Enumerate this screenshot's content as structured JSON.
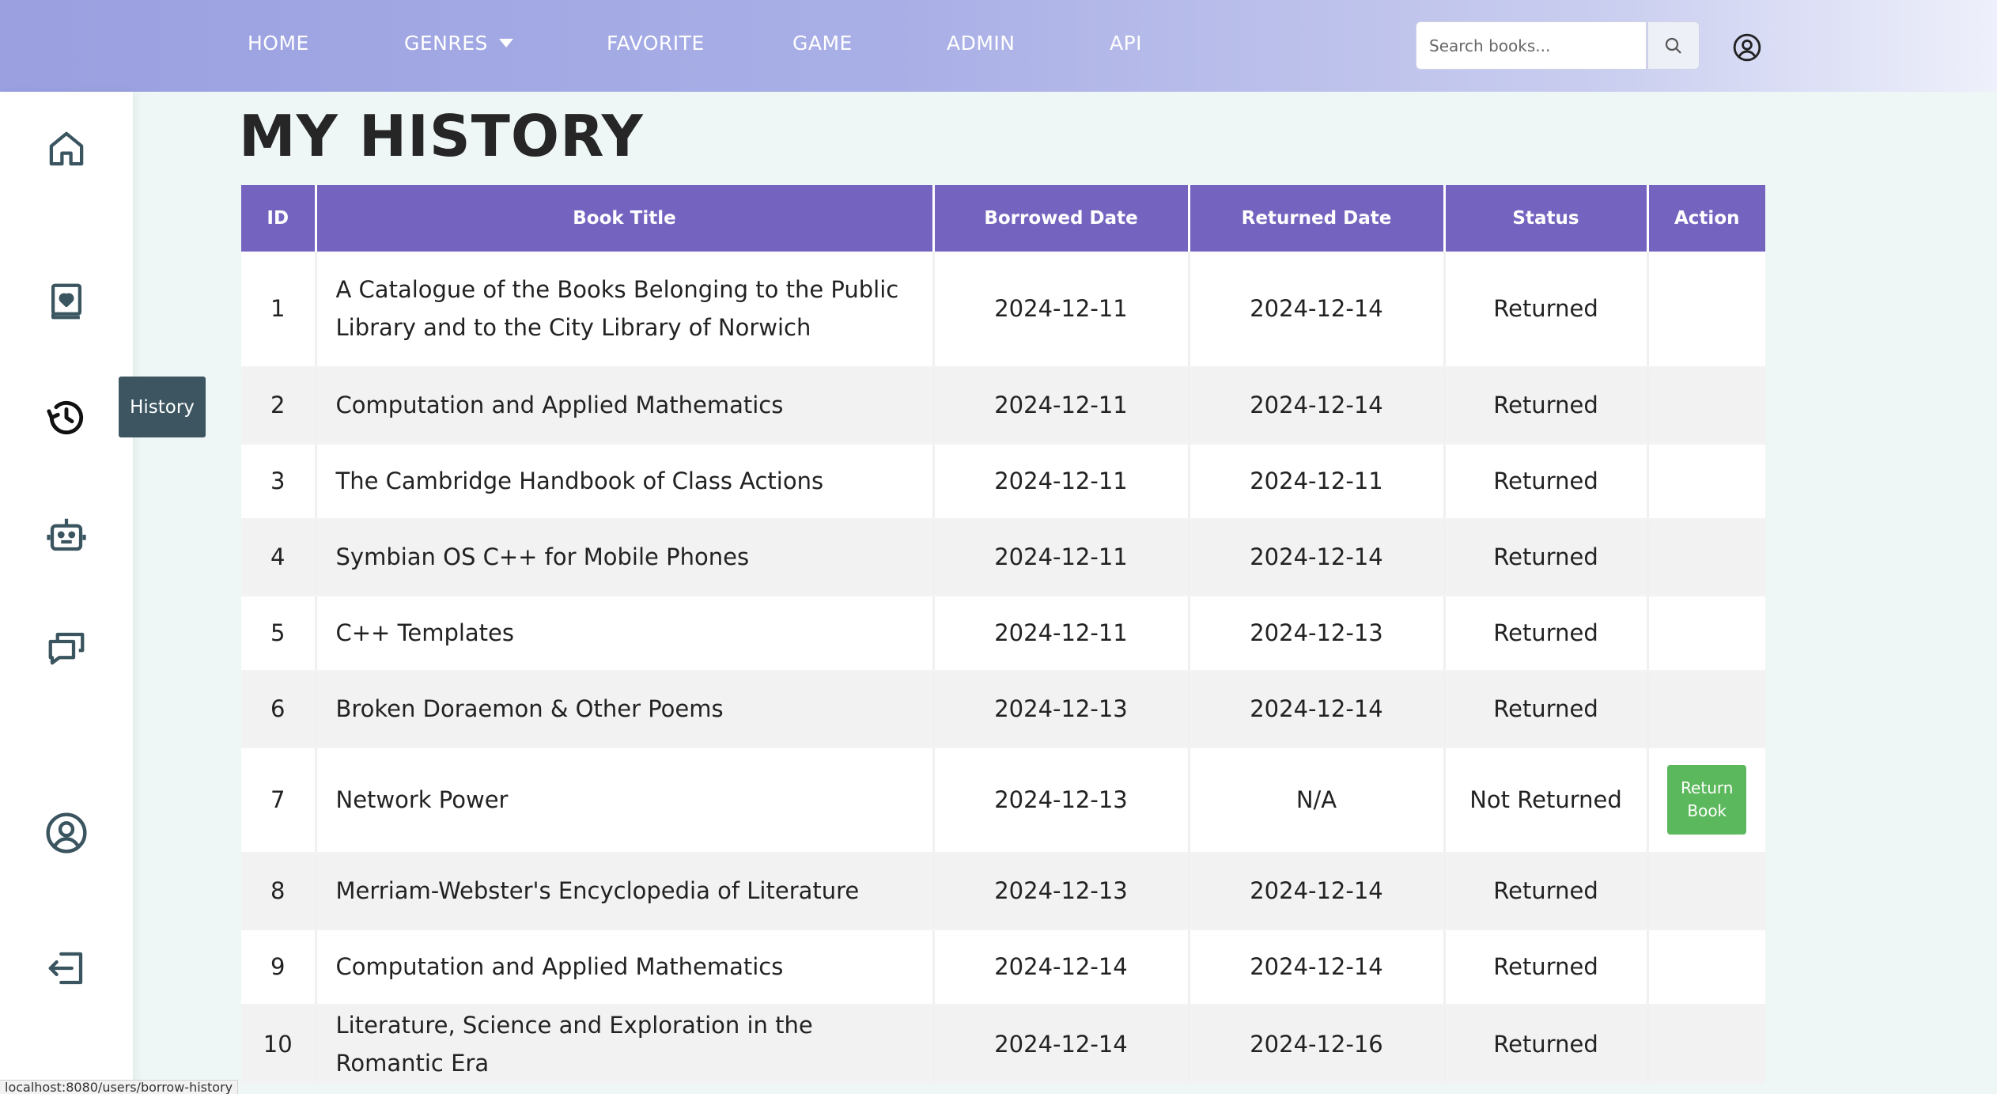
{
  "nav": {
    "items": [
      {
        "label": "HOME"
      },
      {
        "label": "GENRES"
      },
      {
        "label": "FAVORITE"
      },
      {
        "label": "GAME"
      },
      {
        "label": "ADMIN"
      },
      {
        "label": "API"
      }
    ],
    "search_placeholder": "Search books...",
    "search_icon": "search-icon",
    "account_icon": "user-circle-icon"
  },
  "sidebar": {
    "items": [
      {
        "icon": "home-icon"
      },
      {
        "icon": "book-heart-icon"
      },
      {
        "icon": "history-icon",
        "active": true
      },
      {
        "icon": "robot-icon"
      },
      {
        "icon": "chat-icon"
      },
      {
        "icon": "user-circle-icon"
      },
      {
        "icon": "logout-icon"
      }
    ],
    "tooltip": "History"
  },
  "page_title": "MY HISTORY",
  "table": {
    "headers": [
      "ID",
      "Book Title",
      "Borrowed Date",
      "Returned Date",
      "Status",
      "Action"
    ],
    "rows": [
      {
        "id": "1",
        "title": "A Catalogue of the Books Belonging to the Public Library and to the City Library of Norwich",
        "borrowed": "2024-12-11",
        "returned": "2024-12-14",
        "status": "Returned"
      },
      {
        "id": "2",
        "title": "Computation and Applied Mathematics",
        "borrowed": "2024-12-11",
        "returned": "2024-12-14",
        "status": "Returned"
      },
      {
        "id": "3",
        "title": "The Cambridge Handbook of Class Actions",
        "borrowed": "2024-12-11",
        "returned": "2024-12-11",
        "status": "Returned"
      },
      {
        "id": "4",
        "title": "Symbian OS C++ for Mobile Phones",
        "borrowed": "2024-12-11",
        "returned": "2024-12-14",
        "status": "Returned"
      },
      {
        "id": "5",
        "title": "C++ Templates",
        "borrowed": "2024-12-11",
        "returned": "2024-12-13",
        "status": "Returned"
      },
      {
        "id": "6",
        "title": "Broken Doraemon & Other Poems",
        "borrowed": "2024-12-13",
        "returned": "2024-12-14",
        "status": "Returned"
      },
      {
        "id": "7",
        "title": "Network Power",
        "borrowed": "2024-12-13",
        "returned": "N/A",
        "status": "Not Returned",
        "action": "Return Book"
      },
      {
        "id": "8",
        "title": "Merriam-Webster's Encyclopedia of Literature",
        "borrowed": "2024-12-13",
        "returned": "2024-12-14",
        "status": "Returned"
      },
      {
        "id": "9",
        "title": "Computation and Applied Mathematics",
        "borrowed": "2024-12-14",
        "returned": "2024-12-14",
        "status": "Returned"
      },
      {
        "id": "10",
        "title": "Literature, Science and Exploration in the Romantic Era",
        "borrowed": "2024-12-14",
        "returned": "2024-12-16",
        "status": "Returned"
      }
    ]
  },
  "status_bar": "localhost:8080/users/borrow-history",
  "colors": {
    "header_bg": "#7463bf",
    "returned": "#178a17",
    "not_returned": "#e01818",
    "return_button": "#5cb85c",
    "tooltip_bg": "#3c5560"
  }
}
